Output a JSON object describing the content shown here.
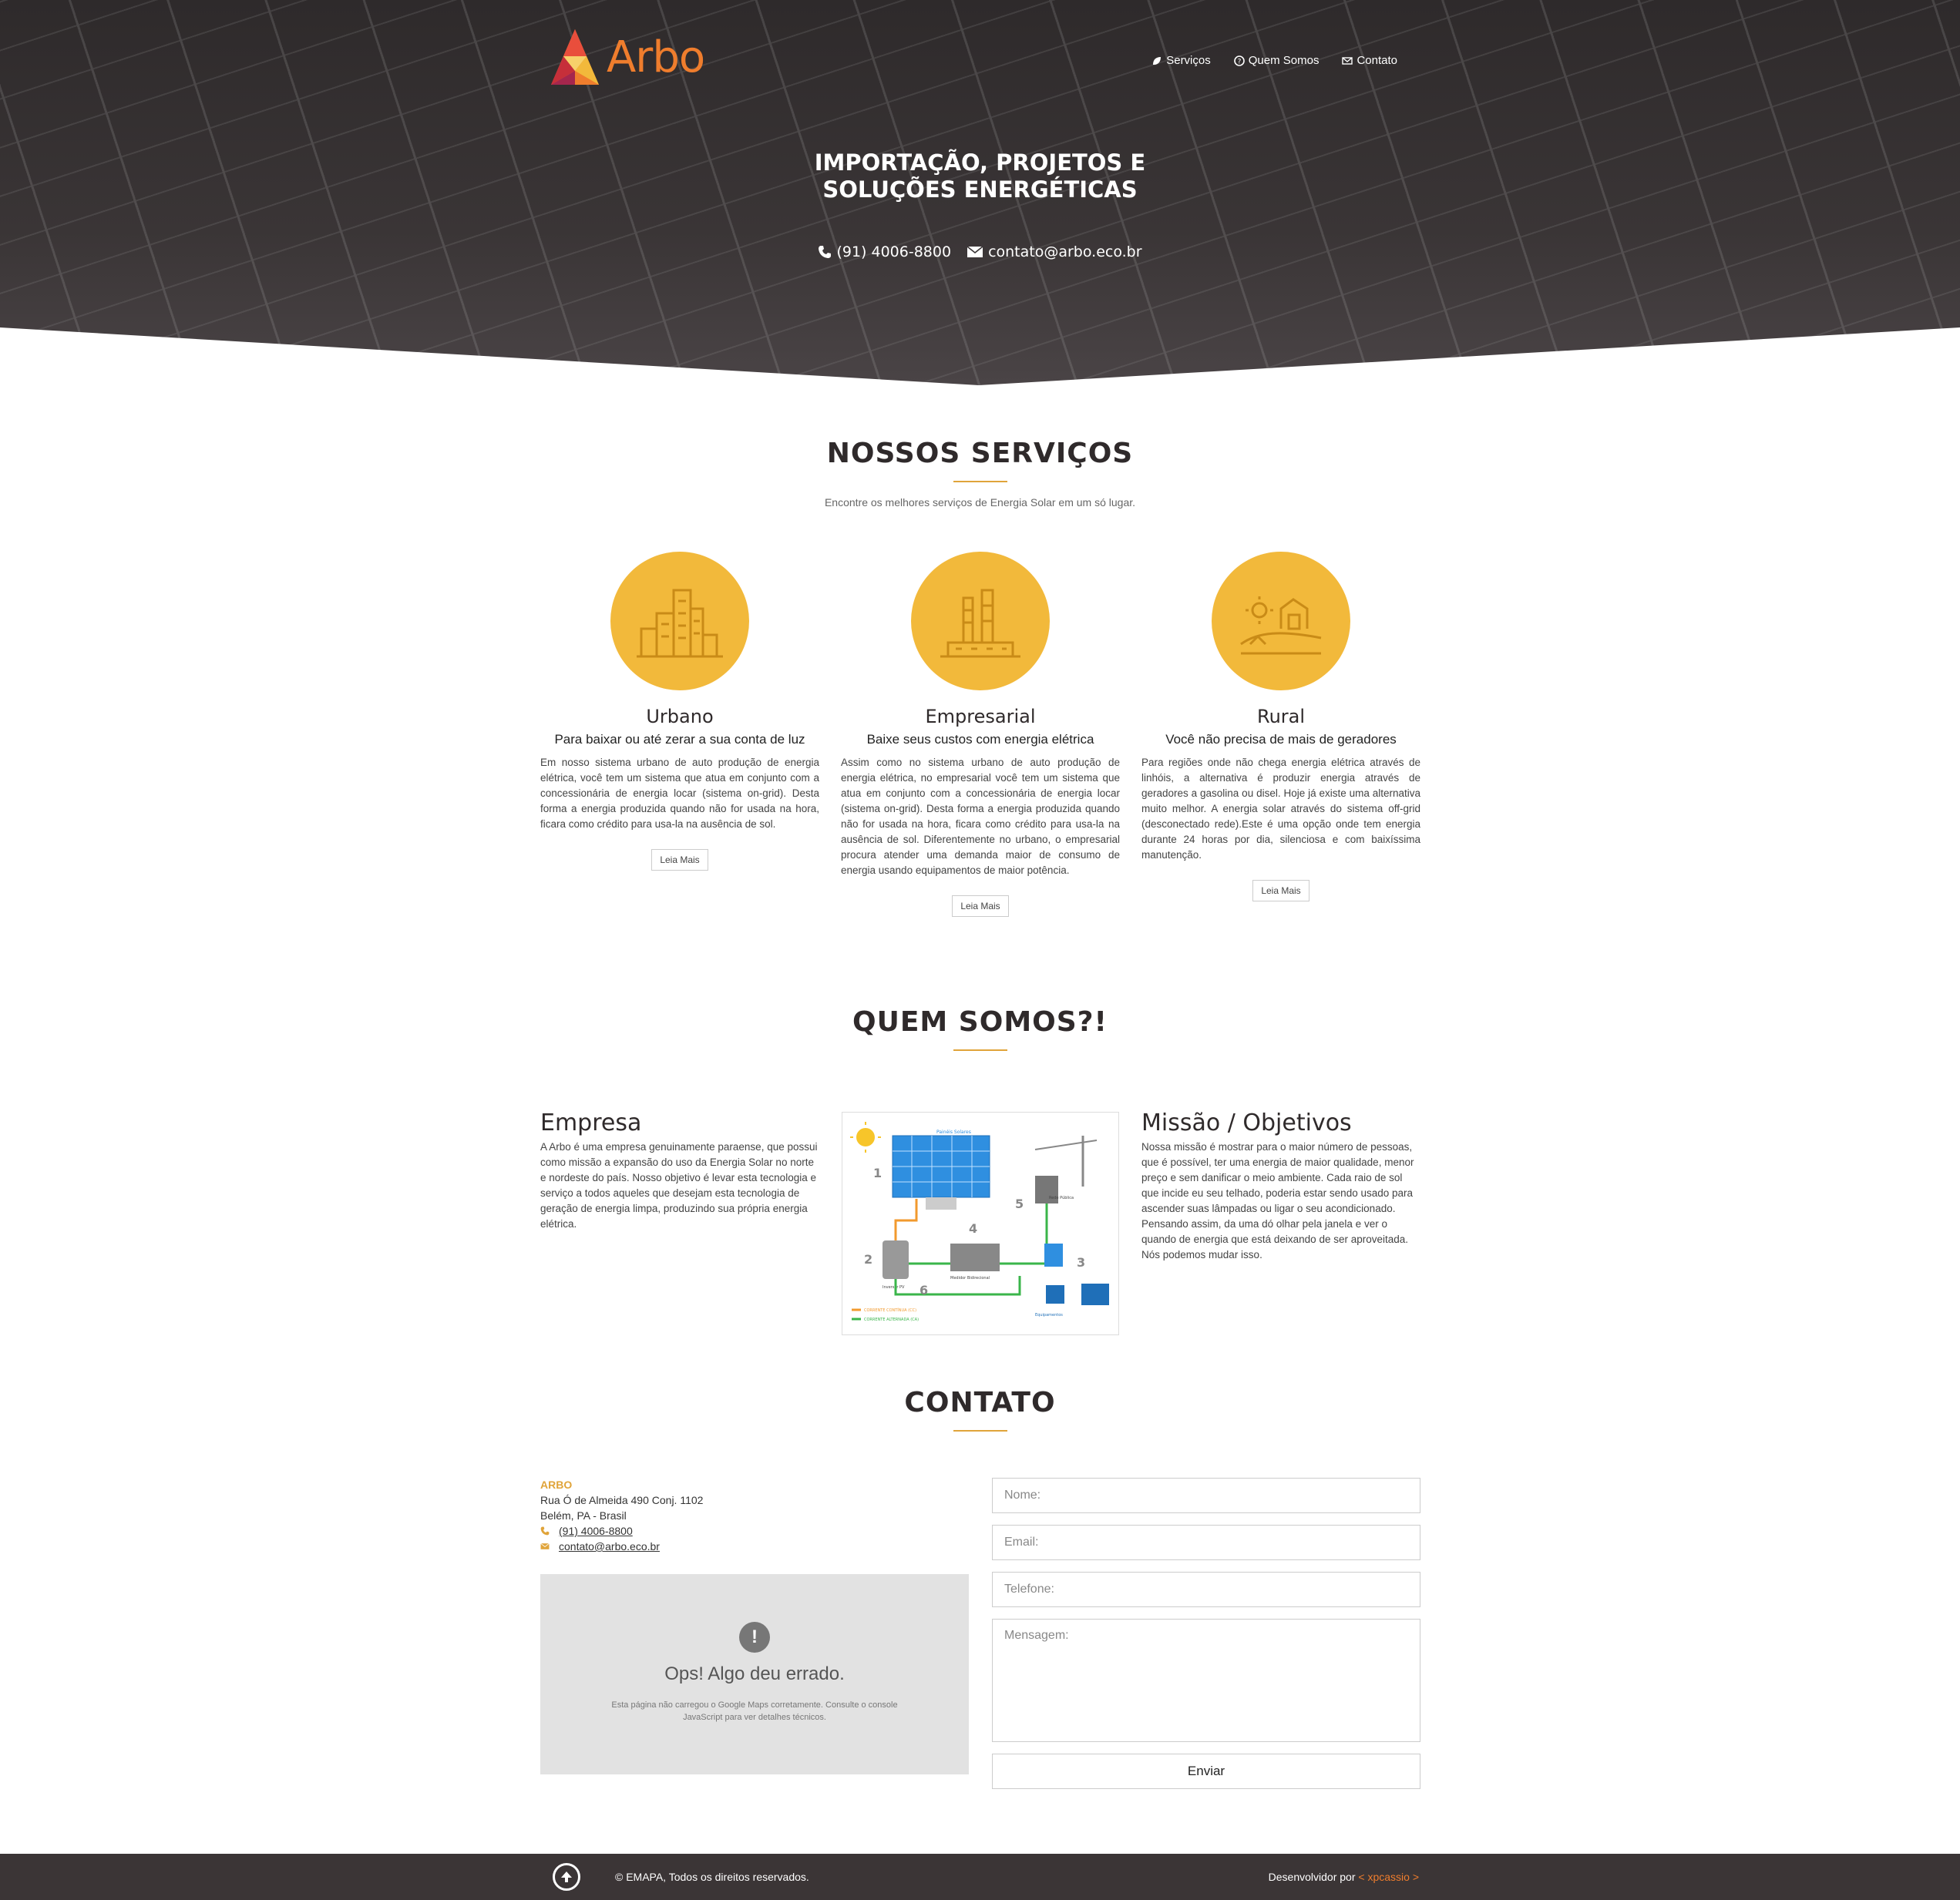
{
  "brand": {
    "logo_text": "Arbo",
    "accent": "#ef7d2d",
    "yellow": "#f2b93b"
  },
  "nav": [
    {
      "label": "Serviços",
      "icon": "leaf-icon"
    },
    {
      "label": "Quem Somos",
      "icon": "question-icon"
    },
    {
      "label": "Contato",
      "icon": "envelope-icon"
    }
  ],
  "hero": {
    "title_line1": "IMPORTAÇÃO, PROJETOS E",
    "title_line2": "SOLUÇÕES ENERGÉTICAS",
    "phone": "(91) 4006-8800",
    "email": "contato@arbo.eco.br"
  },
  "services": {
    "title": "NOSSOS SERVIÇOS",
    "subtitle": "Encontre os melhores serviços de Energia Solar em um só lugar.",
    "items": [
      {
        "name": "Urbano",
        "tagline": "Para baixar ou até zerar a sua conta de luz",
        "text": "Em nosso sistema urbano de auto produção de energia elétrica, você tem um sistema que atua em conjunto com a concessionária de energia locar (sistema on-grid). Desta forma a energia produzida quando não for usada na hora, ficara como crédito para usa-la na ausência de sol.",
        "button": "Leia Mais"
      },
      {
        "name": "Empresarial",
        "tagline": "Baixe seus custos com energia elétrica",
        "text": "Assim como no sistema urbano de auto produção de energia elétrica, no empresarial você tem um sistema que atua em conjunto com a concessionária de energia locar (sistema on-grid). Desta forma a energia produzida quando não for usada na hora, ficara como crédito para usa-la na ausência de sol. Diferentemente no urbano, o empresarial procura atender uma demanda maior de consumo de energia usando equipamentos de maior potência.",
        "button": "Leia Mais"
      },
      {
        "name": "Rural",
        "tagline": "Você não precisa de mais de geradores",
        "text": "Para regiões onde não chega energia elétrica através de linhóis, a alternativa é produzir energia através de geradores a gasolina ou disel. Hoje já existe uma alternativa muito melhor. A energia solar através do sistema off-grid (desconectado rede).Este é uma opção onde tem energia durante 24 horas por dia, silenciosa e com baixíssima manutenção.",
        "button": "Leia Mais"
      }
    ]
  },
  "about": {
    "title": "QUEM SOMOS?!",
    "empresa_title": "Empresa",
    "empresa_text": "A Arbo é uma empresa genuinamente paraense, que possui como missão a expansão do uso da Energia Solar no norte e nordeste do país. Nosso objetivo é levar esta tecnologia e serviço a todos aqueles que desejam esta tecnologia de geração de energia limpa, produzindo sua própria energia elétrica.",
    "missao_title": "Missão / Objetivos",
    "missao_text": "Nossa missão é mostrar para o maior número de pessoas, que é possível, ter uma energia de maior qualidade, menor preço e sem danificar o meio ambiente. Cada raio de sol que incide eu seu telhado, poderia estar sendo usado para ascender suas lâmpadas ou ligar o seu acondicionado. Pensando assim, da uma dó olhar pela janela e ver o quando de energia que está deixando de ser aproveitada. Nós podemos mudar isso.",
    "diagram_labels": {
      "panel": "Painéis Solares",
      "grid": "Rede Pública",
      "inverter": "Inversor PV",
      "meter": "Medidor Bidirecional",
      "equip": "Equipamentos",
      "dc": "CORRENTE CONTÍNUA (CC)",
      "ac": "CORRENTE ALTERNADA (CA)",
      "n1": "1",
      "n2": "2",
      "n3": "3",
      "n4": "4",
      "n5": "5",
      "n6": "6"
    }
  },
  "contact": {
    "title": "CONTATO",
    "company": "ARBO",
    "address1": "Rua Ó de Almeida 490 Conj. 1102",
    "address2": "Belém, PA - Brasil",
    "phone": "(91) 4006-8800",
    "email": "contato@arbo.eco.br",
    "map_icon": "!",
    "map_error_title": "Ops! Algo deu errado.",
    "map_error_text": "Esta página não carregou o Google Maps corretamente. Consulte o console JavaScript para ver detalhes técnicos.",
    "form": {
      "name_placeholder": "Nome:",
      "email_placeholder": "Email:",
      "phone_placeholder": "Telefone:",
      "message_placeholder": "Mensagem:",
      "submit": "Enviar"
    }
  },
  "footer": {
    "copyright": "© EMAPA, Todos os direitos reservados.",
    "dev_prefix": "Desenvolvidor por",
    "dev_link": "< xpcassio >"
  }
}
